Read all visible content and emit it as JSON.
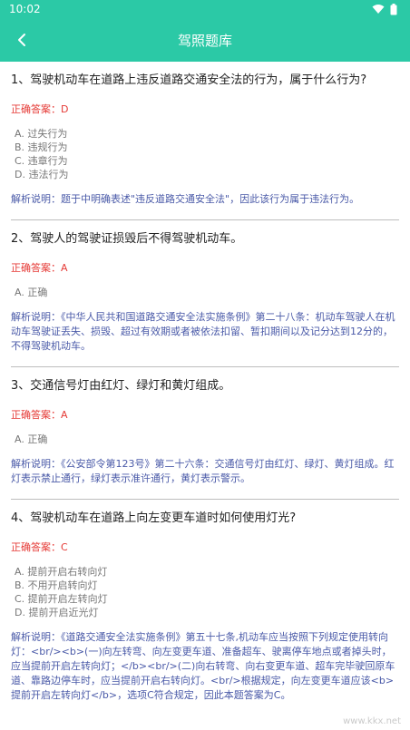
{
  "status_bar": {
    "time": "10:02"
  },
  "app_bar": {
    "title": "驾照题库"
  },
  "labels": {
    "answer_prefix": "正确答案：",
    "explain_prefix": "解析说明："
  },
  "questions": [
    {
      "text": "1、驾驶机动车在道路上违反道路交通安全法的行为，属于什么行为?",
      "answer": "D",
      "options": [
        "A. 过失行为",
        "B. 违规行为",
        "C. 违章行为",
        "D. 违法行为"
      ],
      "explain": "题于中明确表述\"违反道路交通安全法\"，因此该行为属于违法行为。"
    },
    {
      "text": "2、驾驶人的驾驶证损毁后不得驾驶机动车。",
      "answer": "A",
      "options": [
        "A. 正确"
      ],
      "explain": "《中华人民共和国道路交通安全法实施条例》第二十八条：机动车驾驶人在机动车驾驶证丢失、损毁、超过有效期或者被依法扣留、暂扣期间以及记分达到12分的，不得驾驶机动车。"
    },
    {
      "text": "3、交通信号灯由红灯、绿灯和黄灯组成。",
      "answer": "A",
      "options": [
        "A. 正确"
      ],
      "explain": "《公安部令第123号》第二十六条：交通信号灯由红灯、绿灯、黄灯组成。红灯表示禁止通行，绿灯表示准许通行，黄灯表示警示。"
    },
    {
      "text": "4、驾驶机动车在道路上向左变更车道时如何使用灯光?",
      "answer": "C",
      "options": [
        "A. 提前开启右转向灯",
        "B. 不用开启转向灯",
        "C. 提前开启左转向灯",
        "D. 提前开启近光灯"
      ],
      "explain": "《道路交通安全法实施条例》第五十七条,机动车应当按照下列规定使用转向灯：<br/><b>(一)向左转弯、向左变更车道、准备超车、驶离停车地点或者掉头时，应当提前开启左转向灯；</b><br/>(二)向右转弯、向右变更车道、超车完毕驶回原车道、靠路边停车时，应当提前开启右转向灯。<br/>根据规定，向左变更车道应该<b>提前开启左转向灯</b>，选项C符合规定，因此本题答案为C。"
    }
  ],
  "watermark": "www.kkx.net"
}
